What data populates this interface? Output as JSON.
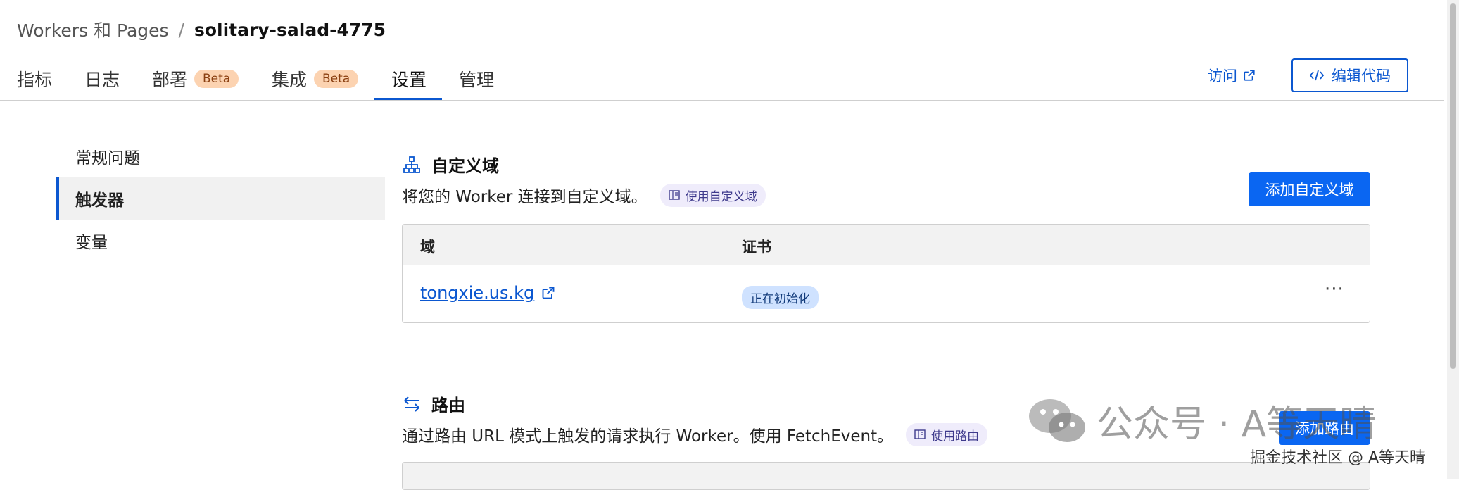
{
  "breadcrumb": {
    "parent": "Workers 和 Pages",
    "separator": "/",
    "current": "solitary-salad-4775"
  },
  "tabs": [
    {
      "label": "指标"
    },
    {
      "label": "日志"
    },
    {
      "label": "部署",
      "badge": "Beta"
    },
    {
      "label": "集成",
      "badge": "Beta"
    },
    {
      "label": "设置",
      "active": true
    },
    {
      "label": "管理"
    }
  ],
  "header_actions": {
    "visit": "访问",
    "edit_code": "编辑代码"
  },
  "sidebar": {
    "items": [
      {
        "label": "常规问题"
      },
      {
        "label": "触发器",
        "active": true
      },
      {
        "label": "变量"
      }
    ]
  },
  "custom_domains": {
    "title": "自定义域",
    "description": "将您的 Worker 连接到自定义域。",
    "doc_link": "使用自定义域",
    "add_button": "添加自定义域",
    "columns": [
      "域",
      "证书"
    ],
    "rows": [
      {
        "domain": "tongxie.us.kg",
        "cert_status": "正在初始化",
        "actions": "···"
      }
    ]
  },
  "routes": {
    "title": "路由",
    "description": "通过路由 URL 模式上触发的请求执行 Worker。使用 FetchEvent。",
    "doc_link": "使用路由",
    "add_button": "添加路由"
  },
  "watermark": {
    "main": "公众号 · A等天晴",
    "sub": "掘金技术社区 @ A等天晴"
  },
  "colors": {
    "accent": "#0b57d0",
    "primary_button": "#0a66f2",
    "beta_badge": "#fcd3b1",
    "status_badge": "#cfe2ff"
  }
}
